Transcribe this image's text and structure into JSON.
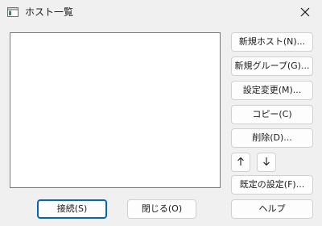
{
  "window": {
    "title": "ホスト一覧",
    "icon": "window-app-icon",
    "close_icon": "close-icon"
  },
  "host_list": {
    "items": []
  },
  "side_buttons": {
    "new_host": "新規ホスト(N)...",
    "new_group": "新規グループ(G)...",
    "edit_settings": "設定変更(M)...",
    "copy": "コピー(C)",
    "delete": "削除(D)...",
    "move_up_icon": "arrow-up-icon",
    "move_down_icon": "arrow-down-icon",
    "default_settings": "既定の設定(F)...",
    "help": "ヘルプ"
  },
  "bottom_buttons": {
    "connect": "接続(S)",
    "close": "閉じる(O)"
  },
  "colors": {
    "background": "#f0f0f0",
    "list_background": "#ffffff",
    "default_button_border": "#0067c0",
    "button_border": "#d0d0d0"
  }
}
